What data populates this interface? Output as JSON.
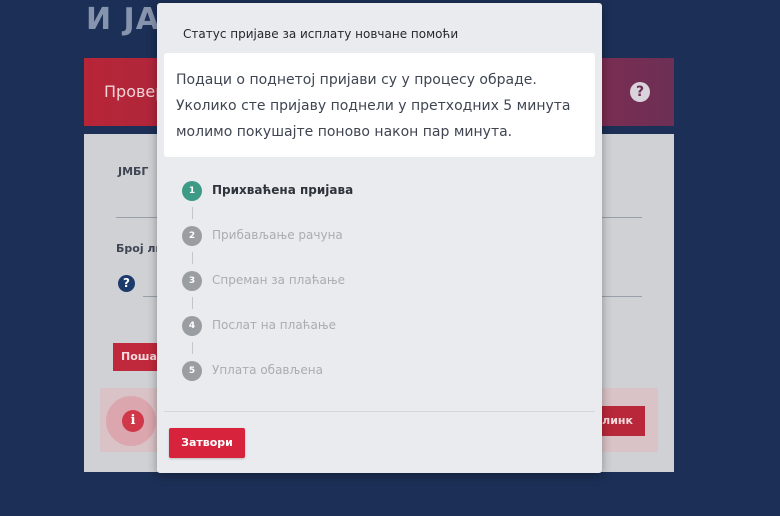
{
  "background": {
    "heading": "И ЈА",
    "banner_text": "Провер",
    "help_icon": "question-circle-icon",
    "field_jmbg_label": "ЈМБГ",
    "field_id_label": "Број ли",
    "help_small_icon": "question-circle-icon",
    "submit_button_label": "Пошал",
    "alert_icon": "info-circle-icon",
    "link_button_label": "линк"
  },
  "modal": {
    "title": "Статус пријаве за исплату новчане помоћи",
    "message_lines": [
      "Подаци о поднетој пријави су у процесу обраде.",
      "Уколико сте пријаву поднели у претходних 5 минута",
      "молимо покушајте поново након пар минута."
    ],
    "steps": [
      {
        "number": "1",
        "label": "Прихваћена пријава",
        "active": true
      },
      {
        "number": "2",
        "label": "Прибављање рачуна",
        "active": false
      },
      {
        "number": "3",
        "label": "Спреман за плаћање",
        "active": false
      },
      {
        "number": "4",
        "label": "Послат на плаћање",
        "active": false
      },
      {
        "number": "5",
        "label": "Уплата обављена",
        "active": false
      }
    ],
    "close_button_label": "Затвори"
  },
  "colors": {
    "page_background": "#1c2f56",
    "active_step": "#3d9a87",
    "inactive_step": "#9a9ea3",
    "primary_button": "#d8233d"
  }
}
